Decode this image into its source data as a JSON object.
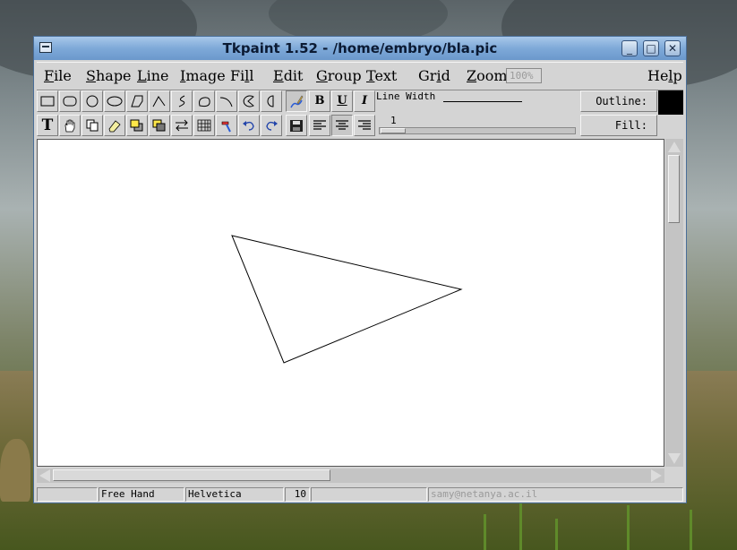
{
  "window": {
    "title": "Tkpaint 1.52 - /home/embryo/bla.pic",
    "controls": {
      "minimize": "_",
      "maximize": "□",
      "close": "✕"
    }
  },
  "menubar": {
    "items": [
      {
        "ul": "F",
        "rest": "ile"
      },
      {
        "ul": "S",
        "rest": "hape"
      },
      {
        "ul": "L",
        "rest": "ine"
      },
      {
        "ul": "I",
        "rest": "mage"
      },
      {
        "pre": "Fi",
        "ul": "l",
        "rest": "l"
      },
      {
        "ul": "E",
        "rest": "dit"
      },
      {
        "ul": "G",
        "rest": "roup"
      },
      {
        "ul": "T",
        "rest": "ext"
      },
      {
        "pre": "Gr",
        "ul": "i",
        "rest": "d"
      },
      {
        "ul": "Z",
        "rest": "oom"
      }
    ],
    "zoom_value": "100%",
    "help": {
      "pre": "He",
      "ul": "l",
      "rest": "p"
    }
  },
  "toolbar": {
    "text_tool": "T",
    "bold": "B",
    "underline": "U",
    "italic": "I"
  },
  "line_width": {
    "label": "Line Width",
    "value": "1"
  },
  "side": {
    "outline_label": "Outline:",
    "fill_label": "Fill:",
    "outline_color": "#000000"
  },
  "status": {
    "mode": "Free Hand",
    "font": "Helvetica",
    "size": "10",
    "email": "samy@netanya.ac.il"
  }
}
